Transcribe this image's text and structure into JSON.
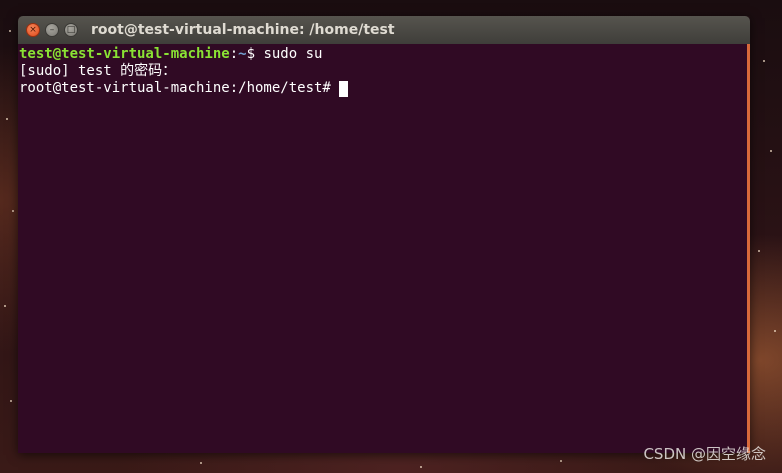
{
  "window": {
    "title": "root@test-virtual-machine: /home/test",
    "controls": {
      "close_glyph": "×",
      "minimize_glyph": "–",
      "maximize_glyph": "□"
    }
  },
  "terminal": {
    "background_color": "#300a24",
    "prompt_color": "#8ae234",
    "path_color": "#729fcf",
    "line1": {
      "user_host": "test@test-virtual-machine",
      "separator": ":",
      "path": "~",
      "prompt_symbol": "$ ",
      "command": "sudo su"
    },
    "line2": {
      "text": "[sudo] test 的密码："
    },
    "line3": {
      "prompt": "root@test-virtual-machine:/home/test# "
    }
  },
  "watermark": {
    "text": "CSDN @因空缘念"
  }
}
